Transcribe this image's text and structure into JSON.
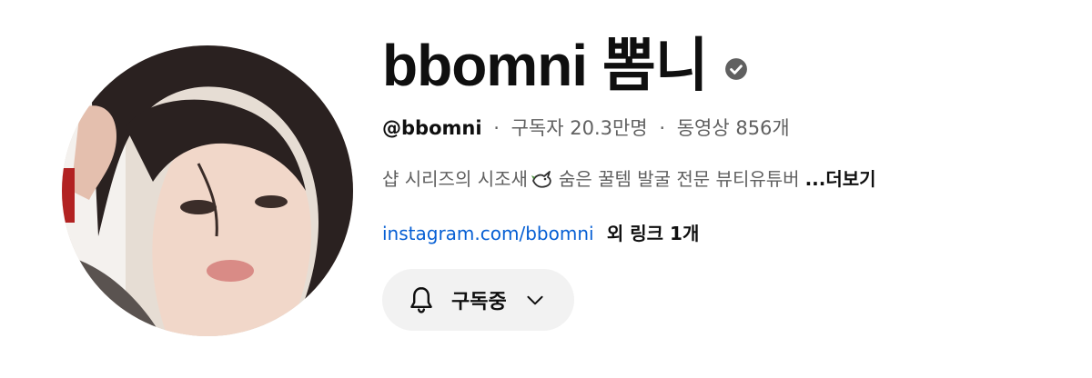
{
  "channel": {
    "name": "bbomni 뽐니",
    "verified": true,
    "handle": "@bbomni",
    "subscribers": "구독자 20.3만명",
    "videos": "동영상 856개",
    "separator": "·",
    "description": {
      "part1": "샵 시리즈의 시조새",
      "part2": "숨은 꿀템 발굴 전문 뷰티유튜버",
      "more": "...더보기"
    },
    "link": {
      "url_text": "instagram.com/bbomni",
      "extra": "외 링크 1개"
    }
  },
  "subscribe_button": {
    "label": "구독중"
  },
  "icons": {
    "verified": "verified-check-icon",
    "dove": "dove-emoji-icon",
    "bell": "bell-icon",
    "chevron": "chevron-down-icon"
  },
  "colors": {
    "link": "#065fd4",
    "secondary_text": "#606060",
    "button_bg": "#f2f2f2"
  }
}
